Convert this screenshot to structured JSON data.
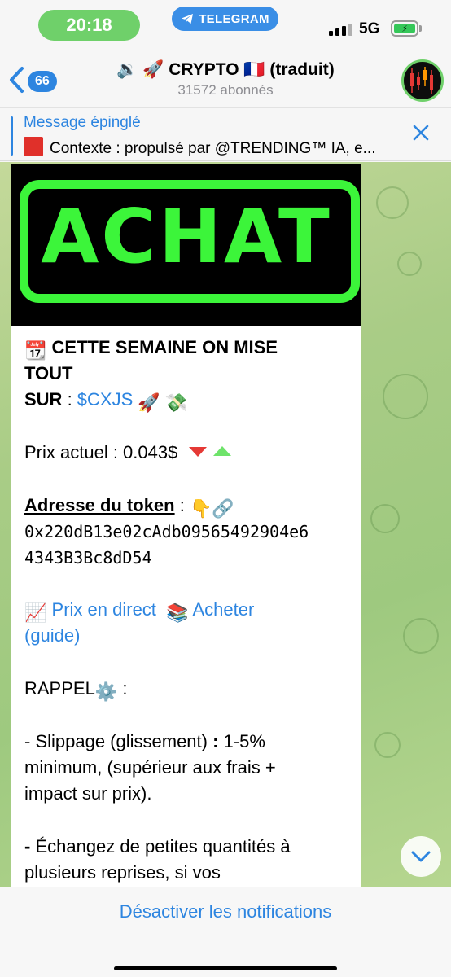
{
  "status_bar": {
    "time": "20:18",
    "app_pill": "TELEGRAM",
    "network": "5G",
    "accent_green": "#6fd06a"
  },
  "header": {
    "back_count": "66",
    "title": "🔉 🚀 CRYPTO 🇫🇷 (traduit)",
    "subtitle": "31572 abonnés"
  },
  "pinned": {
    "label": "Message épinglé",
    "text": "Contexte : propulsé par @TRENDING™ IA, e..."
  },
  "message": {
    "image_text": "ACHAT",
    "line1_emoji": "📆",
    "line1": "CETTE SEMAINE ON MISE",
    "line2": "TOUT",
    "sur_label": "SUR",
    "sur_sep": " : ",
    "ticker": "$CXJS",
    "ticker_emojis": "🚀 💸",
    "price_label": "Prix actuel : 0.043$",
    "address_label": "Adresse du token",
    "address_sep": " : ",
    "address_emojis": "👇🔗",
    "address_line1": "0x220dB13e02cAdb09565492904e6",
    "address_line2": "4343B3Bc8dD54",
    "live_emoji": "📈",
    "live_link": "Prix en direct",
    "buy_emoji": "📚",
    "buy_link": "Acheter",
    "buy_link2": "(guide)",
    "rappel": "RAPPEL",
    "rappel_emoji": "⚙️",
    "rappel_sep": " :",
    "slippage1": "- Slippage (glissement) ",
    "slippage_colon": ":",
    "slippage2": " 1-5%",
    "slippage3": "minimum, (supérieur aux frais +",
    "slippage4": "impact sur prix).",
    "exchange_dash": "-",
    "exchange1": " Échangez de petites quantités à",
    "exchange2": "plusieurs reprises, si vos"
  },
  "bottom": {
    "mute_label": "Désactiver les notifications"
  }
}
